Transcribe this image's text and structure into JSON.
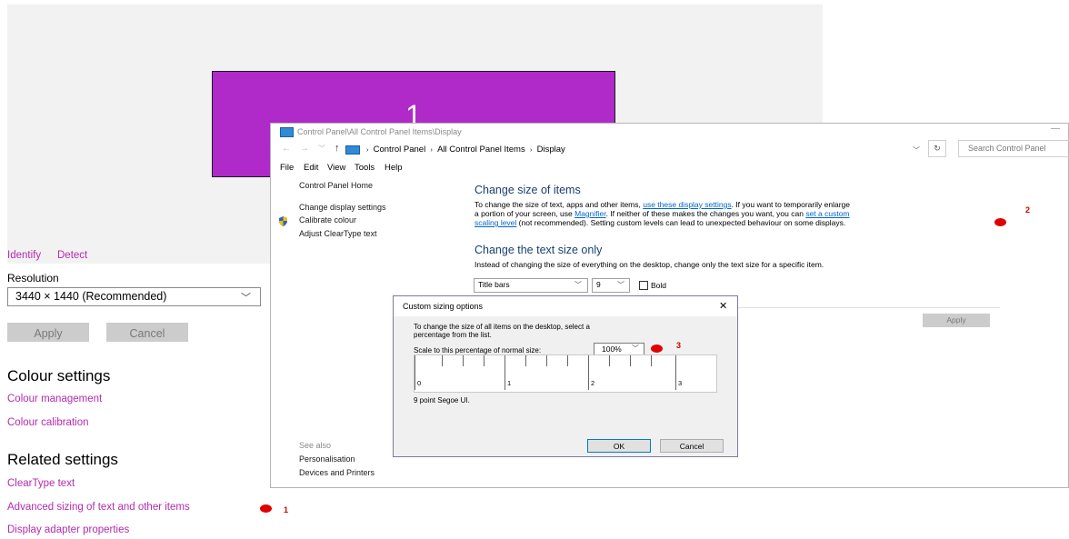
{
  "display": {
    "monitor_number": "1",
    "identify": "Identify",
    "detect": "Detect",
    "resolution_label": "Resolution",
    "resolution_value": "3440 × 1440 (Recommended)",
    "apply": "Apply",
    "cancel": "Cancel",
    "colour_settings_heading": "Colour settings",
    "colour_management": "Colour management",
    "colour_calibration": "Colour calibration",
    "related_settings_heading": "Related settings",
    "cleartype_text": "ClearType text",
    "advanced_sizing": "Advanced sizing of text and other items",
    "display_adapter": "Display adapter properties",
    "accent_color": "#b52bb0",
    "monitor_color": "#b02ac9"
  },
  "markers": {
    "m1": "1",
    "m2": "2",
    "m3": "3",
    "color": "#e00000"
  },
  "control_panel": {
    "title": "Control Panel\\All Control Panel Items\\Display",
    "breadcrumb": [
      "Control Panel",
      "All Control Panel Items",
      "Display"
    ],
    "search_placeholder": "Search Control Panel",
    "menu": [
      "File",
      "Edit",
      "View",
      "Tools",
      "Help"
    ],
    "sidebar": {
      "home": "Control Panel Home",
      "change_display": "Change display settings",
      "calibrate": "Calibrate colour",
      "cleartype": "Adjust ClearType text",
      "see_also": "See also",
      "personalisation": "Personalisation",
      "devices": "Devices and Printers"
    },
    "change_size_heading": "Change size of items",
    "para1_a": "To change the size of text, apps and other items, ",
    "para1_link1": "use these display settings",
    "para1_b": ". If you want to temporarily enlarge",
    "para2_a": "a portion of your screen, use ",
    "para2_link2": "Magnifier",
    "para2_b": ". If neither of these makes the changes you want, you can ",
    "para2_link3": "set a custom",
    "para3_link3": "scaling level",
    "para3_b": " (not recommended). Setting custom levels can lead to unexpected behaviour on some displays.",
    "text_size_heading": "Change the text size only",
    "text_size_desc": "Instead of changing the size of everything on the desktop, change only the text size for a specific item.",
    "item_select": "Title bars",
    "size_select": "9",
    "bold_label": "Bold",
    "apply": "Apply"
  },
  "dialog": {
    "title": "Custom sizing options",
    "close": "✕",
    "desc_line1": "To change the size of all items on the desktop, select a",
    "desc_line2": "percentage from the list.",
    "scale_label": "Scale to this percentage of normal size:",
    "scale_value": "100%",
    "ruler_labels": [
      "0",
      "1",
      "2",
      "3"
    ],
    "font_note": "9 point Segoe UI.",
    "ok": "OK",
    "cancel": "Cancel"
  }
}
